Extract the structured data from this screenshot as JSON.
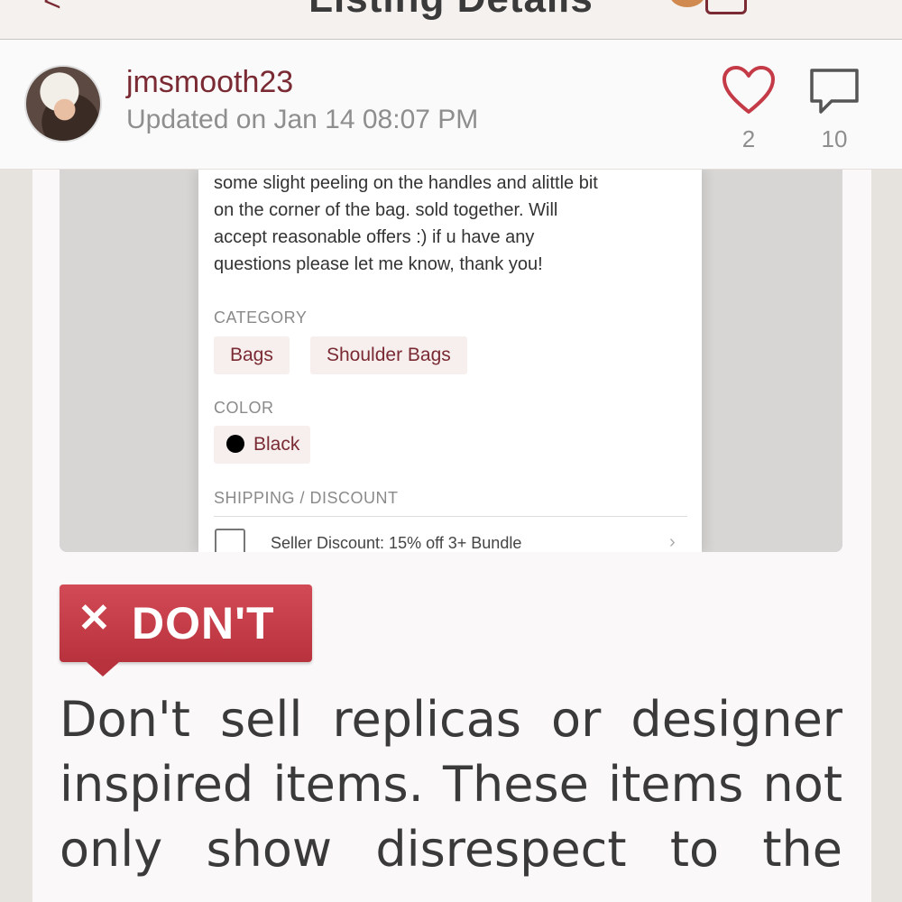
{
  "nav": {
    "back_glyph": "<",
    "title": "Listing Details"
  },
  "header": {
    "username": "jmsmooth23",
    "updated": "Updated on Jan 14 08:07 PM",
    "likes": "2",
    "comments": "10"
  },
  "listing": {
    "description_lines": [
      "some slight peeling on the handles and alittle bit",
      "on the corner of the bag. sold together. Will",
      "accept reasonable offers :) if u have any",
      "questions please let me know, thank you!"
    ],
    "category_label": "CATEGORY",
    "categories": [
      "Bags",
      "Shoulder Bags"
    ],
    "color_label": "COLOR",
    "color_value": "Black",
    "shipping_label": "SHIPPING / DISCOUNT",
    "seller_discount": "Seller Discount: 15% off 3+ Bundle",
    "chevron": "›"
  },
  "badge": {
    "x_glyph": "✕",
    "label": "DON'T"
  },
  "body_lines": [
    "Don't sell replicas or designer",
    "inspired items. These items not",
    "only show disrespect to the"
  ],
  "colors": {
    "accent": "#7a2a33",
    "badge_red": "#c63e49"
  }
}
